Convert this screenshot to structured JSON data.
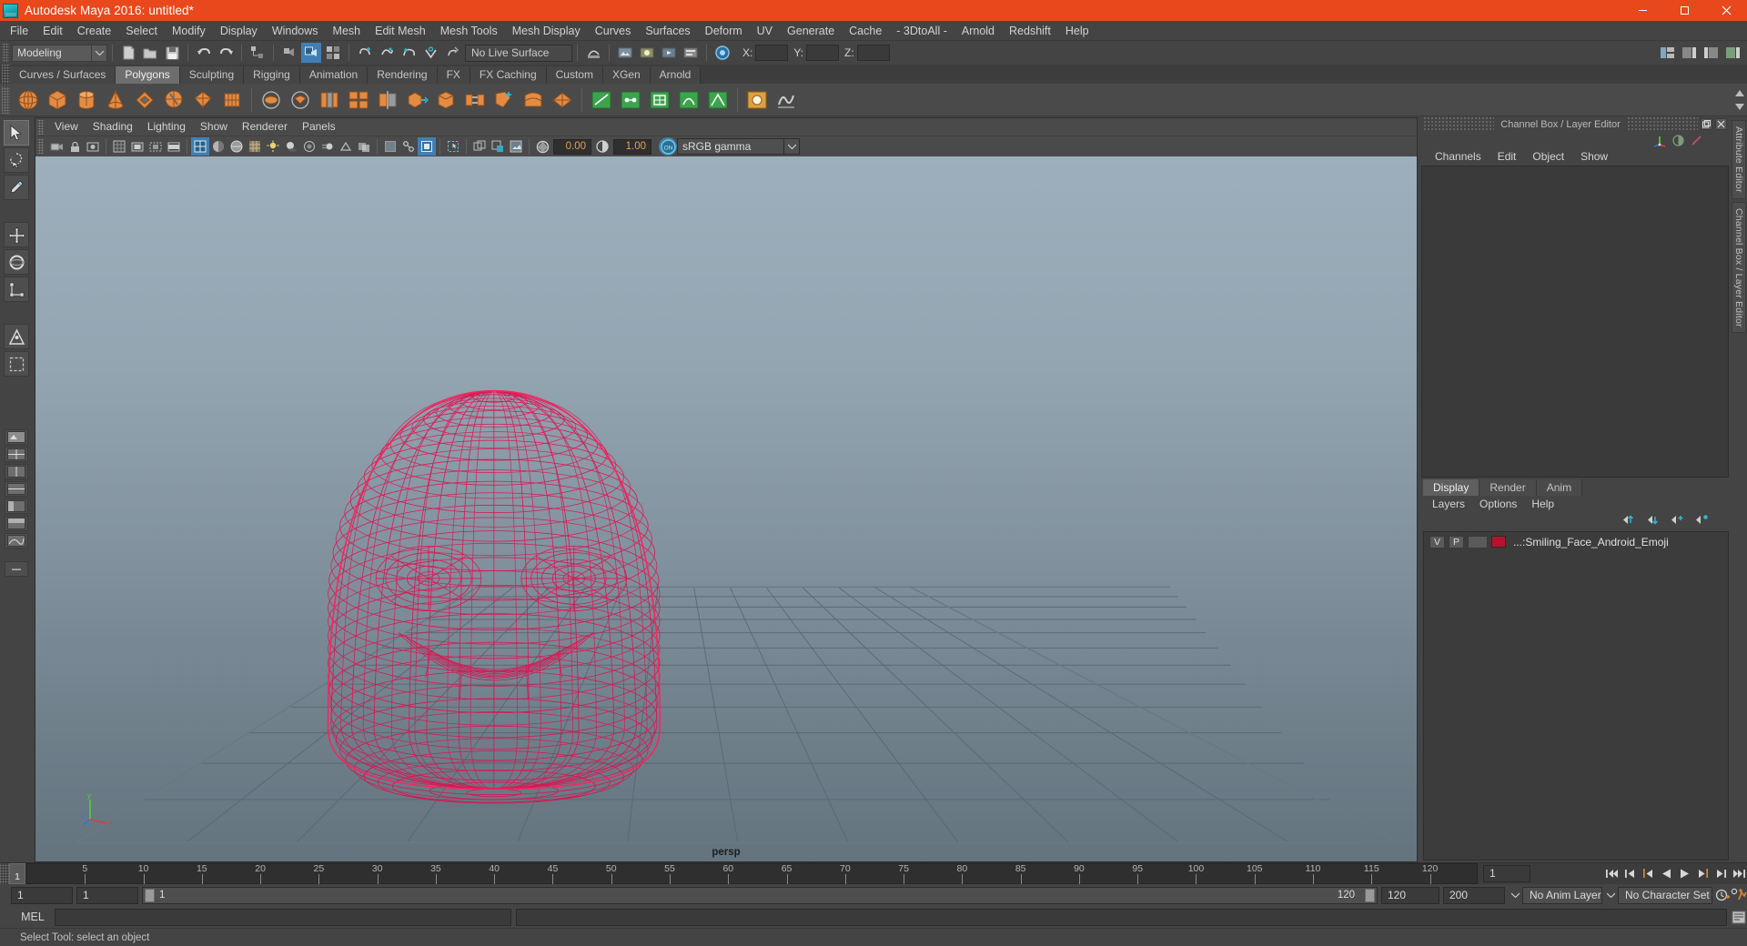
{
  "window": {
    "title": "Autodesk Maya 2016: untitled*",
    "logo_icon": "maya-logo-icon",
    "minimize_icon": "minimize-icon",
    "maximize_icon": "maximize-icon",
    "close_icon": "close-icon",
    "titlebar_color": "#e8481c"
  },
  "menubar": {
    "items": [
      "File",
      "Edit",
      "Create",
      "Select",
      "Modify",
      "Display",
      "Windows",
      "Mesh",
      "Edit Mesh",
      "Mesh Tools",
      "Mesh Display",
      "Curves",
      "Surfaces",
      "Deform",
      "UV",
      "Generate",
      "Cache",
      "- 3DtoAll -",
      "Arnold",
      "Redshift",
      "Help"
    ]
  },
  "statusbar": {
    "mode": "Modeling",
    "live_surface": "No Live Surface",
    "coords": [
      {
        "label": "X:",
        "value": ""
      },
      {
        "label": "Y:",
        "value": ""
      },
      {
        "label": "Z:",
        "value": ""
      }
    ]
  },
  "shelf": {
    "tabs": [
      {
        "label": "Curves / Surfaces",
        "active": false
      },
      {
        "label": "Polygons",
        "active": true
      },
      {
        "label": "Sculpting",
        "active": false
      },
      {
        "label": "Rigging",
        "active": false
      },
      {
        "label": "Animation",
        "active": false
      },
      {
        "label": "Rendering",
        "active": false
      },
      {
        "label": "FX",
        "active": false
      },
      {
        "label": "FX Caching",
        "active": false
      },
      {
        "label": "Custom",
        "active": false
      },
      {
        "label": "XGen",
        "active": false
      },
      {
        "label": "Arnold",
        "active": false
      }
    ],
    "icons": [
      "poly-sphere-icon",
      "poly-cube-icon",
      "poly-cylinder-icon",
      "poly-cone-icon",
      "poly-torus-icon",
      "poly-plane-icon",
      "poly-pyramid-icon",
      "poly-prism-icon",
      "poly-pipe-icon",
      "poly-helix-icon",
      "poly-soccer-ball-icon",
      "combine-icon",
      "separate-icon",
      "booleans-icon",
      "smooth-icon",
      "mirror-geometry-icon",
      "extrude-icon",
      "bevel-icon",
      "bridge-icon",
      "append-polygon-icon",
      "wedge-face-icon",
      "poke-face-icon",
      "multicut-icon",
      "target-weld-icon",
      "quad-draw-icon",
      "sculpt-tool-icon",
      "smooth-tool-icon",
      "relax-tool-icon",
      "grab-tool-icon",
      "pinch-tool-icon",
      "flatten-tool-icon",
      "foamy-tool-icon"
    ]
  },
  "toolbox": {
    "tools": [
      "select-tool-icon",
      "lasso-select-tool-icon",
      "paint-select-tool-icon",
      "move-tool-icon",
      "rotate-tool-icon",
      "scale-tool-icon",
      "last-tool-icon",
      "show-manipulator-icon"
    ],
    "layouts": [
      "single-perspective-layout-icon",
      "four-view-layout-icon",
      "two-pane-side-layout-icon",
      "two-pane-stacked-layout-icon",
      "outliner-persp-layout-icon",
      "hypershade-persp-layout-icon",
      "persp-graph-layout-icon"
    ]
  },
  "viewport": {
    "menus": [
      "View",
      "Shading",
      "Lighting",
      "Show",
      "Renderer",
      "Panels"
    ],
    "camera_label": "persp",
    "toolbar": {
      "exposure_value": "0.00",
      "gamma_value": "1.00",
      "color_management": "sRGB gamma",
      "color_management_on": "ON",
      "icons": [
        "select-camera-icon",
        "lock-camera-icon",
        "camera-attributes-icon",
        "bookmark-icon",
        "image-plane-icon",
        "twopoint-resolution-icon",
        "grid-icon",
        "film-gate-icon",
        "resolution-gate-icon",
        "gate-mask-icon",
        "wireframe-icon",
        "smooth-shade-icon",
        "shaded-wireframe-icon",
        "textured-icon",
        "use-lights-icon",
        "shadows-icon",
        "ambient-occlusion-icon",
        "motion-blur-icon",
        "multisample-icon",
        "depth-peel-icon",
        "xray-icon",
        "xray-joints-icon",
        "xray-active-icon",
        "isolate-select-icon",
        "isolate-add-icon",
        "isolate-remove-icon",
        "exposure-icon",
        "gamma-icon",
        "color-management-toggle-icon"
      ]
    },
    "grid": {
      "color": "#55626c",
      "visible": true
    },
    "mesh": {
      "name": "Smiling_Face_Android_Emoji",
      "wireframe_color": "#e01050",
      "selected": true
    },
    "axis_gizmo": {
      "x_label": "x",
      "y_label": "y",
      "z_label": "z",
      "x_color": "#e03a3a",
      "y_color": "#4fd23a",
      "z_color": "#3a6fe0"
    }
  },
  "right_panel": {
    "channel_box": {
      "title": "Channel Box / Layer Editor",
      "undock_icon": "undock-icon",
      "close_icon": "close-panel-icon",
      "menus": [
        "Channels",
        "Edit",
        "Object",
        "Show"
      ],
      "toolbar_icons": [
        "channel-box-icon",
        "attribute-editor-toggle-icon",
        "tool-settings-icon"
      ]
    },
    "layer_editor": {
      "tabs": [
        {
          "label": "Display",
          "active": true
        },
        {
          "label": "Render",
          "active": false
        },
        {
          "label": "Anim",
          "active": false
        }
      ],
      "menus": [
        "Layers",
        "Options",
        "Help"
      ],
      "toolbar_icons": [
        "move-layer-up-icon",
        "move-layer-down-icon",
        "new-layer-icon",
        "new-layer-from-selected-icon"
      ],
      "layers": [
        {
          "visibility": "V",
          "playback": "P",
          "shading": "",
          "color": "#b4122f",
          "name": "...:Smiling_Face_Android_Emoji"
        }
      ]
    },
    "vertical_tabs": [
      "Attribute Editor",
      "Channel Box / Layer Editor"
    ]
  },
  "timeline": {
    "current_frame": "1",
    "ticks": [
      {
        "label": "5",
        "frame": 5
      },
      {
        "label": "10",
        "frame": 10
      },
      {
        "label": "15",
        "frame": 15
      },
      {
        "label": "20",
        "frame": 20
      },
      {
        "label": "25",
        "frame": 25
      },
      {
        "label": "30",
        "frame": 30
      },
      {
        "label": "35",
        "frame": 35
      },
      {
        "label": "40",
        "frame": 40
      },
      {
        "label": "45",
        "frame": 45
      },
      {
        "label": "50",
        "frame": 50
      },
      {
        "label": "55",
        "frame": 55
      },
      {
        "label": "60",
        "frame": 60
      },
      {
        "label": "65",
        "frame": 65
      },
      {
        "label": "70",
        "frame": 70
      },
      {
        "label": "75",
        "frame": 75
      },
      {
        "label": "80",
        "frame": 80
      },
      {
        "label": "85",
        "frame": 85
      },
      {
        "label": "90",
        "frame": 90
      },
      {
        "label": "95",
        "frame": 95
      },
      {
        "label": "100",
        "frame": 100
      },
      {
        "label": "105",
        "frame": 105
      },
      {
        "label": "110",
        "frame": 110
      },
      {
        "label": "115",
        "frame": 115
      },
      {
        "label": "120",
        "frame": 120
      }
    ],
    "end_marker": "120",
    "frame_field": "1",
    "playback_icons": [
      "go-to-start-icon",
      "step-back-keyframe-icon",
      "step-back-frame-icon",
      "play-backwards-icon",
      "play-forwards-icon",
      "step-forward-frame-icon",
      "step-forward-keyframe-icon",
      "go-to-end-icon"
    ]
  },
  "range_slider": {
    "start_field": "1",
    "range_start_field": "1",
    "slider_start_label": "1",
    "slider_end_label": "120",
    "range_end_field": "120",
    "end_field": "200",
    "anim_layer": "No Anim Layer",
    "character_set": "No Character Set",
    "auto_key_icon": "auto-keyframe-icon",
    "anim_prefs_icon": "animation-preferences-icon"
  },
  "command_line": {
    "label": "MEL",
    "input_value": "",
    "script_editor_icon": "script-editor-icon"
  },
  "status_line": {
    "message": "Select Tool: select an object"
  }
}
